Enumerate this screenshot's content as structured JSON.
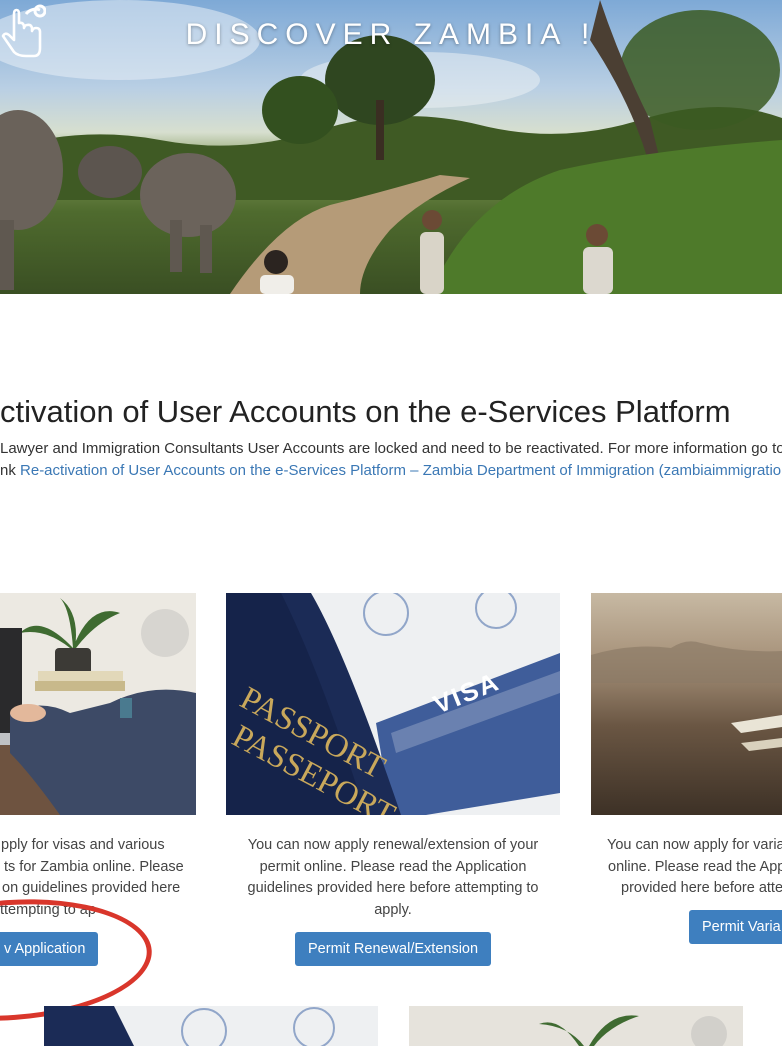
{
  "hero": {
    "title": "DISCOVER ZAMBIA !"
  },
  "notice": {
    "title": "ctivation of User Accounts on the e-Services Platform",
    "line1": "Lawyer and Immigration Consultants User Accounts are locked and need to be reactivated. For more information go to",
    "line2_prefix": "nk ",
    "line2_link": "Re-activation of User Accounts on the e-Services Platform – Zambia Department of Immigration (zambiaimmigration"
  },
  "cards": [
    {
      "text_lines": [
        "pply for visas and various",
        "ts for Zambia online. Please",
        "on guidelines provided here",
        "ttempting to ap"
      ],
      "button": "v Application"
    },
    {
      "image_text": {
        "passport": "PASSPORT",
        "passport2": "PASSEPORT",
        "visa": "VISA"
      },
      "text_lines": [
        "You can now apply renewal/extension of your",
        "permit online. Please read the Application",
        "guidelines provided here before attempting to",
        "apply."
      ],
      "button": "Permit Renewal/Extension"
    },
    {
      "text_lines": [
        "You can now apply for varia",
        "online. Please read the App",
        "provided here before atte"
      ],
      "button": "Permit Varia"
    }
  ],
  "colors": {
    "accent_button": "#3e7fbf",
    "link": "#3b78b5",
    "annotation_circle": "#d9362b"
  }
}
